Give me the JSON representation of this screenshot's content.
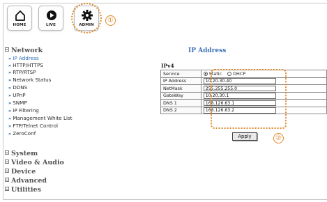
{
  "nav": {
    "home_label": "HOME",
    "live_label": "LIVE",
    "admin_label": "ADMIN"
  },
  "callouts": {
    "one": "①",
    "two": "②"
  },
  "sidebar": {
    "network_label": "Network",
    "network_items": [
      "IP Address",
      "HTTP/HTTPS",
      "RTP/RTSP",
      "Network Status",
      "DDNS",
      "UPnP",
      "SNMP",
      "IP Filtering",
      "Management White List",
      "FTP/Telnet Control",
      "ZeroConf"
    ],
    "sections": [
      "System",
      "Video & Audio",
      "Device",
      "Advanced",
      "Utilities"
    ]
  },
  "main": {
    "title": "IP Address",
    "subtitle": "IPv4",
    "service_label": "Service",
    "radio_static": "Static",
    "radio_dhcp": "DHCP",
    "fields": [
      {
        "label": "IP Address",
        "value": "10.20.30.40"
      },
      {
        "label": "NetMask",
        "value": "255.255.255.0"
      },
      {
        "label": "GateWay",
        "value": "10.20.30.1"
      },
      {
        "label": "DNS 1",
        "value": "168.126.63.1"
      },
      {
        "label": "DNS 2",
        "value": "168.126.63.2"
      }
    ],
    "apply_label": "Apply"
  },
  "colors": {
    "accent": "#3c70b8",
    "callout": "#e08a2c"
  },
  "icons": [
    "home-icon",
    "play-icon",
    "gear-icon",
    "arrow-icon",
    "collapse-box-icon"
  ]
}
